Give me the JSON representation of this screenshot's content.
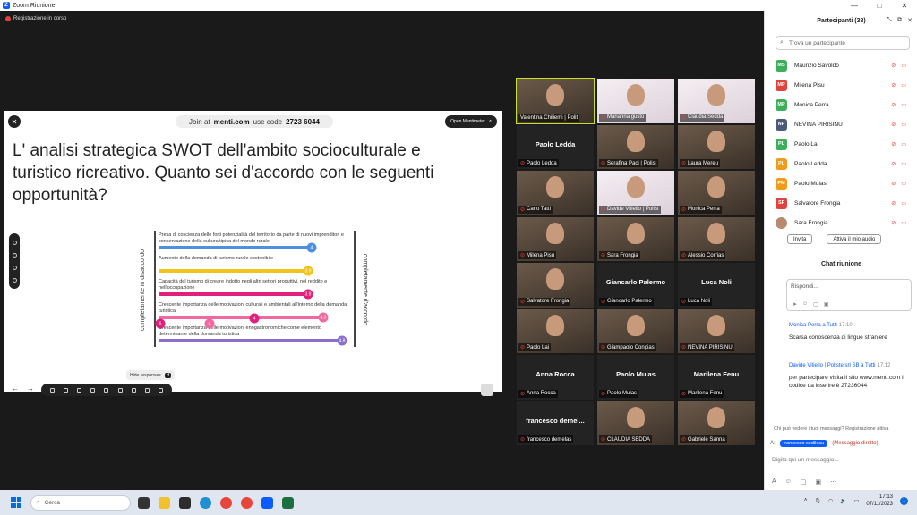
{
  "window": {
    "title": "Zoom Riunione",
    "controls": [
      "—",
      "□",
      "✕"
    ]
  },
  "recording": {
    "label": "Registrazione in corso"
  },
  "slide": {
    "join_prefix": "Join at",
    "join_site": "menti.com",
    "use_code_label": "use code",
    "code": "2723 6044",
    "open_button": "Open Mentimeter",
    "question": "L' analisi strategica SWOT dell'ambito socioculturale e turistico ricreativo. Quanto sei d'accordo con le seguenti opportunità?",
    "scale_left": "completamente in disaccordo",
    "scale_right": "completamente d'accordo",
    "hide_responses": "Hide responses",
    "hide_key": "H"
  },
  "chart_data": {
    "type": "bar",
    "xlim": [
      0,
      5
    ],
    "items": [
      {
        "label": "Presa di coscienza delle forti potenzialità del territorio da parte di nuovi imprenditori e conservazione della cultura tipica del mondo rurale",
        "value": 4,
        "value_label": "4",
        "color": "#4f8fe0"
      },
      {
        "label": "Aumento della domanda di turismo rurale sostenibile",
        "value": 3.9,
        "value_label": "3.9",
        "color": "#f2c418"
      },
      {
        "label": "Capacità del turismo di creare indotto negli altri settori produttivi, nel reddito e nell'occupazione",
        "value": 3.9,
        "value_label": "3.9",
        "color": "#e0207a"
      },
      {
        "label": "Crescente importanza delle motivazioni culturali e ambientali all'interno della domanda turistica",
        "value": 4.3,
        "value_label": "4.3",
        "color": "#f06aa0"
      },
      {
        "label": "Crescente importanza delle motivazioni enogastronomiche come elemento determinante della domanda turistica",
        "value": 4.8,
        "value_label": "4.8",
        "color": "#8a6fcf"
      }
    ],
    "overlay_dots": [
      {
        "value_label": "4",
        "color": "#e0207a"
      },
      {
        "value_label": "4",
        "color": "#f06aa0"
      },
      {
        "value_label": "6",
        "color": "#e0207a"
      }
    ]
  },
  "gallery": [
    {
      "name": "Valentina Chiliemi | Polit",
      "kind": "video",
      "active": true,
      "muted": false
    },
    {
      "name": "Marianna gusto",
      "kind": "light",
      "muted": true
    },
    {
      "name": "Claudia Sedda",
      "kind": "light",
      "muted": true
    },
    {
      "name": "Paolo Ledda",
      "kind": "name",
      "big": "Paolo Ledda",
      "muted": true
    },
    {
      "name": "Serafina Paci | Polist",
      "kind": "video",
      "muted": true
    },
    {
      "name": "Laura Mereu",
      "kind": "video",
      "muted": true
    },
    {
      "name": "Carlo Tatti",
      "kind": "video",
      "muted": true
    },
    {
      "name": "Davide Vitiello | Polist",
      "kind": "light",
      "muted": true
    },
    {
      "name": "Monica Perra",
      "kind": "video",
      "muted": true
    },
    {
      "name": "Milena Pisu",
      "kind": "video",
      "muted": true
    },
    {
      "name": "Sara Frongia",
      "kind": "video",
      "muted": true
    },
    {
      "name": "Alessio Corrias",
      "kind": "video",
      "muted": true
    },
    {
      "name": "Salvatore Frongia",
      "kind": "video",
      "muted": true
    },
    {
      "name": "Giancarlo Palermo",
      "kind": "name",
      "big": "Giancarlo Palermo",
      "muted": true
    },
    {
      "name": "Luca Noli",
      "kind": "name",
      "big": "Luca Noli",
      "muted": true
    },
    {
      "name": "Paolo Lai",
      "kind": "video",
      "muted": true
    },
    {
      "name": "Giampaolo Congias",
      "kind": "video",
      "muted": true
    },
    {
      "name": "NEVINA PIRISINU",
      "kind": "video",
      "muted": true
    },
    {
      "name": "Anna Rocca",
      "kind": "name",
      "big": "Anna Rocca",
      "muted": true
    },
    {
      "name": "Paolo Mulas",
      "kind": "name",
      "big": "Paolo Mulas",
      "muted": true
    },
    {
      "name": "Marilena Fenu",
      "kind": "name",
      "big": "Marilena Fenu",
      "muted": true
    },
    {
      "name": "francesco demelas",
      "kind": "name",
      "big": "francesco demel...",
      "muted": true
    },
    {
      "name": "CLAUDIA SEDDA",
      "kind": "video",
      "muted": true
    },
    {
      "name": "Gabriele Sanna",
      "kind": "video",
      "muted": true
    }
  ],
  "participants": {
    "title": "Partecipanti (38)",
    "search_placeholder": "Trova un partecipante",
    "list": [
      {
        "initials": "MS",
        "name": "Maurizio Savoldo",
        "color": "#3dae5a"
      },
      {
        "initials": "MP",
        "name": "Milena Pisu",
        "color": "#e0433c"
      },
      {
        "initials": "MP",
        "name": "Monica Perra",
        "color": "#3dae5a"
      },
      {
        "initials": "NP",
        "name": "NEVINA PIRISINU",
        "color": "#4a5a78"
      },
      {
        "initials": "PL",
        "name": "Paolo Lai",
        "color": "#3dae5a"
      },
      {
        "initials": "PL",
        "name": "Paolo Ledda",
        "color": "#f29a1a"
      },
      {
        "initials": "PM",
        "name": "Paolo Mulas",
        "color": "#f29a1a"
      },
      {
        "initials": "SF",
        "name": "Salvatore Frongia",
        "color": "#e0433c"
      },
      {
        "initials": "",
        "name": "Sara Frongia",
        "color": "#b98a70"
      }
    ],
    "invite_button": "Invita",
    "unmute_all_button": "Attiva il mio audio"
  },
  "chat": {
    "title": "Chat riunione",
    "reply_placeholder": "Rispondi...",
    "messages": [
      {
        "initials": "MP",
        "color": "#f29a1a",
        "sender": "Monica Perra a Tutti",
        "time": "17:10",
        "text": "Scarsa conoscenza di lingue straniere"
      },
      {
        "initials": "D",
        "color": "#1a8a6a",
        "sender": "Davide Vitiello | Poliste srl SB a Tutti",
        "time": "17:12",
        "text": "per partecipare visita il sito www.menti.com il codice da inserire è 27236044"
      }
    ],
    "privacy_note": "Chi può vedere i tuoi messaggi? Registrazione attiva",
    "to_label": "A:",
    "to_recipient": "francesco sedilesu",
    "direct_label": "(Messaggio diretto)",
    "input_placeholder": "Digita qui un messaggio..."
  },
  "taskbar": {
    "search_placeholder": "Cerca",
    "time": "17:13",
    "date": "07/11/2023",
    "notification_count": "1"
  }
}
